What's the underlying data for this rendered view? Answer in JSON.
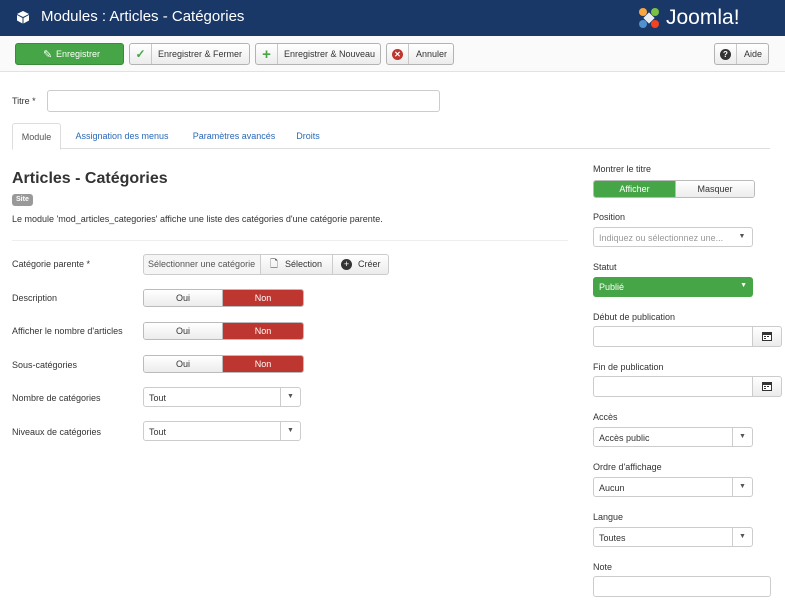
{
  "header": {
    "title": "Modules : Articles - Catégories",
    "logo_text": "Joomla!"
  },
  "toolbar": {
    "save_label": "Enregistrer",
    "save_close_label": "Enregistrer & Fermer",
    "save_new_label": "Enregistrer & Nouveau",
    "cancel_label": "Annuler",
    "help_label": "Aide"
  },
  "form": {
    "title_label": "Titre *",
    "title_value": ""
  },
  "tabs": [
    "Module",
    "Assignation des menus",
    "Paramètres avancés",
    "Droits"
  ],
  "module": {
    "name": "Articles - Catégories",
    "badge": "Site",
    "description": "Le module 'mod_articles_categories' affiche une liste des catégories d'une catégorie parente."
  },
  "fields": {
    "parent_label": "Catégorie parente *",
    "parent_placeholder": "Sélectionner une catégorie",
    "selection_label": "Sélection",
    "create_label": "Créer",
    "description_label": "Description",
    "count_label": "Afficher le nombre d'articles",
    "subcat_label": "Sous-catégories",
    "nb_label": "Nombre de catégories",
    "nb_value": "Tout",
    "levels_label": "Niveaux de catégories",
    "levels_value": "Tout",
    "yes": "Oui",
    "no": "Non"
  },
  "sidebar": {
    "show_title_label": "Montrer le titre",
    "show_label": "Afficher",
    "hide_label": "Masquer",
    "position_label": "Position",
    "position_placeholder": "Indiquez ou sélectionnez une...",
    "status_label": "Statut",
    "status_value": "Publié",
    "pub_start_label": "Début de publication",
    "pub_end_label": "Fin de publication",
    "access_label": "Accès",
    "access_value": "Accès public",
    "order_label": "Ordre d'affichage",
    "order_value": "Aucun",
    "language_label": "Langue",
    "language_value": "Toutes",
    "note_label": "Note"
  },
  "colors": {
    "header_bg": "#1a3867",
    "success": "#46a546",
    "danger": "#bd362f",
    "link": "#2a69b8"
  }
}
